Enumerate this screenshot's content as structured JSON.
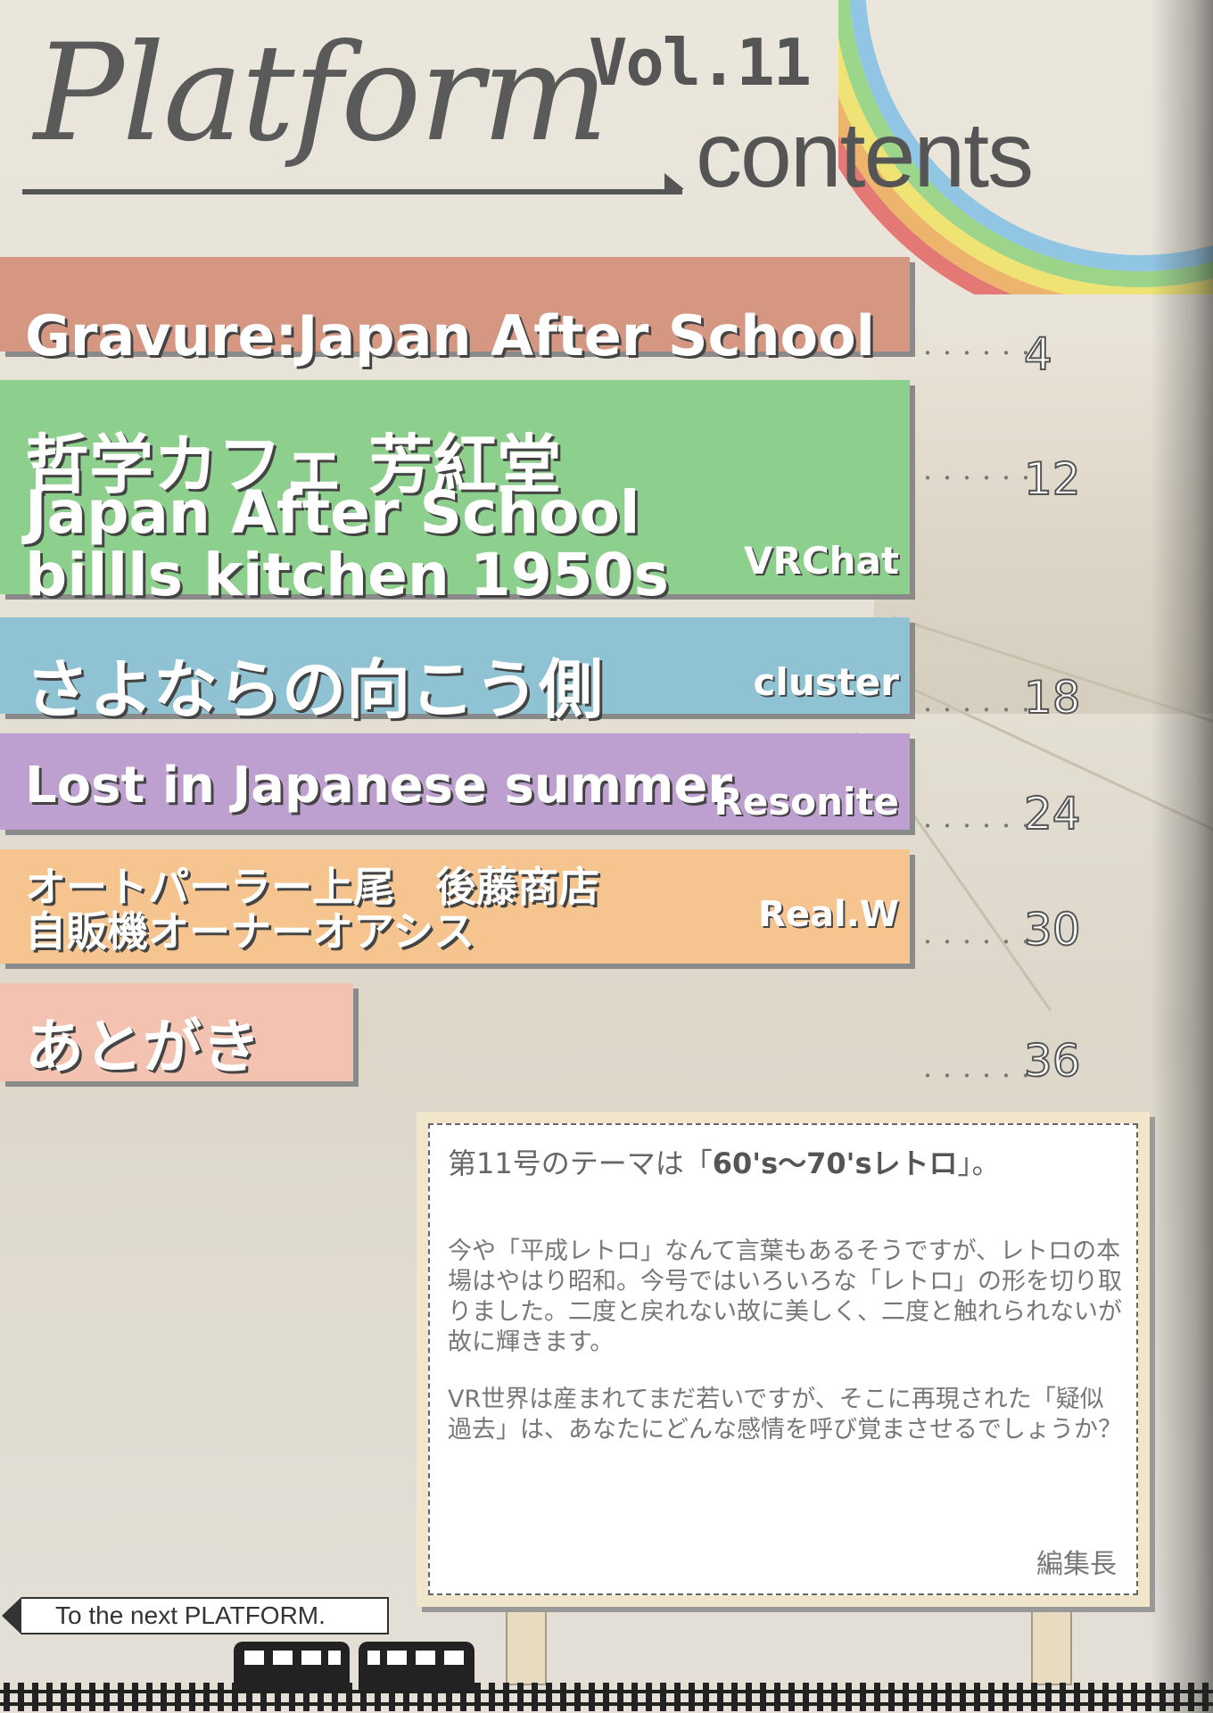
{
  "header": {
    "title": "Platform",
    "volume": "Vol.11",
    "contents_label": "contents"
  },
  "toc": [
    {
      "lines": [
        "Gravure:Japan After School"
      ],
      "platform": "",
      "page": "4",
      "color": "#d59682"
    },
    {
      "lines": [
        "哲学カフェ 芳紅堂",
        "Japan After School",
        "billls kitchen 1950s"
      ],
      "platform": "VRChat",
      "page": "12",
      "color": "#8dcf8c"
    },
    {
      "lines": [
        "さよならの向こう側"
      ],
      "platform": "cluster",
      "page": "18",
      "color": "#8fc3d3"
    },
    {
      "lines": [
        "Lost in Japanese summer"
      ],
      "platform": "Resonite",
      "page": "24",
      "color": "#bda0cf"
    },
    {
      "lines": [
        "オートパーラー上尾　後藤商店",
        "自販機オーナーオアシス"
      ],
      "platform": "Real.W",
      "page": "30",
      "color": "#f6c48f"
    },
    {
      "lines": [
        "あとがき"
      ],
      "platform": "",
      "page": "36",
      "color": "#f4c2b0"
    }
  ],
  "note": {
    "title_prefix": "第11号のテーマは「",
    "title_theme": "60's～70'sレトロ",
    "title_suffix": "」。",
    "paragraph1": "今や「平成レトロ」なんて言葉もあるそうですが、レトロの本場はやはり昭和。今号ではいろいろな「レトロ」の形を切り取りました。二度と戻れない故に美しく、二度と触れられないが故に輝きます。",
    "paragraph2": "VR世界は産まれてまだ若いですが、そこに再現された「疑似過去」は、あなたにどんな感情を呼び覚まさせるでしょうか？",
    "signature": "編集長"
  },
  "footer": {
    "next_label": "To the next PLATFORM."
  },
  "dots": "・・・・・・"
}
